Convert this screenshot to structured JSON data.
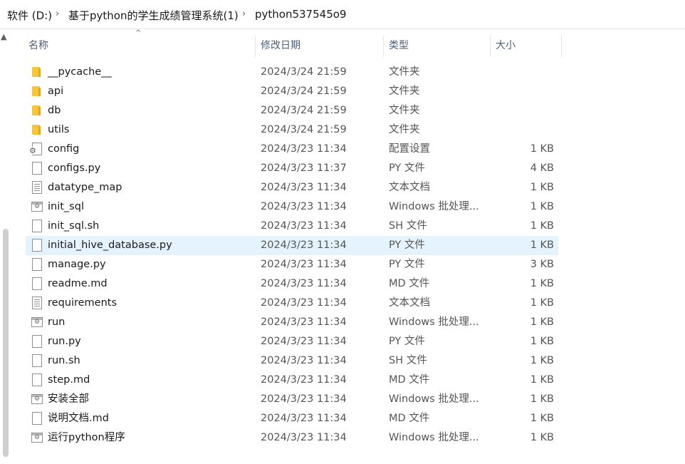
{
  "breadcrumb": {
    "items": [
      "软件 (D:)",
      "基于python的学生成绩管理系统(1)",
      "python537545o9"
    ],
    "separator": "›"
  },
  "columns": {
    "name": "名称",
    "date": "修改日期",
    "type": "类型",
    "size": "大小",
    "sort_indicator": "^"
  },
  "files": [
    {
      "name": "__pycache__",
      "date": "2024/3/24 21:59",
      "type": "文件夹",
      "size": "",
      "icon": "folder-icon"
    },
    {
      "name": "api",
      "date": "2024/3/24 21:59",
      "type": "文件夹",
      "size": "",
      "icon": "folder-icon"
    },
    {
      "name": "db",
      "date": "2024/3/24 21:59",
      "type": "文件夹",
      "size": "",
      "icon": "folder-icon"
    },
    {
      "name": "utils",
      "date": "2024/3/24 21:59",
      "type": "文件夹",
      "size": "",
      "icon": "folder-icon"
    },
    {
      "name": "config",
      "date": "2024/3/23 11:34",
      "type": "配置设置",
      "size": "1 KB",
      "icon": "config-file-icon"
    },
    {
      "name": "configs.py",
      "date": "2024/3/23 11:37",
      "type": "PY 文件",
      "size": "4 KB",
      "icon": "file-icon"
    },
    {
      "name": "datatype_map",
      "date": "2024/3/23 11:34",
      "type": "文本文档",
      "size": "1 KB",
      "icon": "text-file-icon"
    },
    {
      "name": "init_sql",
      "date": "2024/3/23 11:34",
      "type": "Windows 批处理...",
      "size": "1 KB",
      "icon": "batch-file-icon"
    },
    {
      "name": "init_sql.sh",
      "date": "2024/3/23 11:34",
      "type": "SH 文件",
      "size": "1 KB",
      "icon": "file-icon"
    },
    {
      "name": "initial_hive_database.py",
      "date": "2024/3/23 11:34",
      "type": "PY 文件",
      "size": "1 KB",
      "icon": "file-icon",
      "selected": true
    },
    {
      "name": "manage.py",
      "date": "2024/3/23 11:34",
      "type": "PY 文件",
      "size": "3 KB",
      "icon": "file-icon"
    },
    {
      "name": "readme.md",
      "date": "2024/3/23 11:34",
      "type": "MD 文件",
      "size": "1 KB",
      "icon": "file-icon"
    },
    {
      "name": "requirements",
      "date": "2024/3/23 11:34",
      "type": "文本文档",
      "size": "1 KB",
      "icon": "text-file-icon"
    },
    {
      "name": "run",
      "date": "2024/3/23 11:34",
      "type": "Windows 批处理...",
      "size": "1 KB",
      "icon": "batch-file-icon"
    },
    {
      "name": "run.py",
      "date": "2024/3/23 11:34",
      "type": "PY 文件",
      "size": "1 KB",
      "icon": "file-icon"
    },
    {
      "name": "run.sh",
      "date": "2024/3/23 11:34",
      "type": "SH 文件",
      "size": "1 KB",
      "icon": "file-icon"
    },
    {
      "name": "step.md",
      "date": "2024/3/23 11:34",
      "type": "MD 文件",
      "size": "1 KB",
      "icon": "file-icon"
    },
    {
      "name": "安装全部",
      "date": "2024/3/23 11:34",
      "type": "Windows 批处理...",
      "size": "1 KB",
      "icon": "batch-file-icon"
    },
    {
      "name": "说明文档.md",
      "date": "2024/3/23 11:34",
      "type": "MD 文件",
      "size": "1 KB",
      "icon": "file-icon"
    },
    {
      "name": "运行python程序",
      "date": "2024/3/23 11:34",
      "type": "Windows 批处理...",
      "size": "1 KB",
      "icon": "batch-file-icon"
    }
  ],
  "colors": {
    "selected_row": "#e5f3ff",
    "header_text": "#4c607a",
    "folder": "#f6c53a"
  }
}
